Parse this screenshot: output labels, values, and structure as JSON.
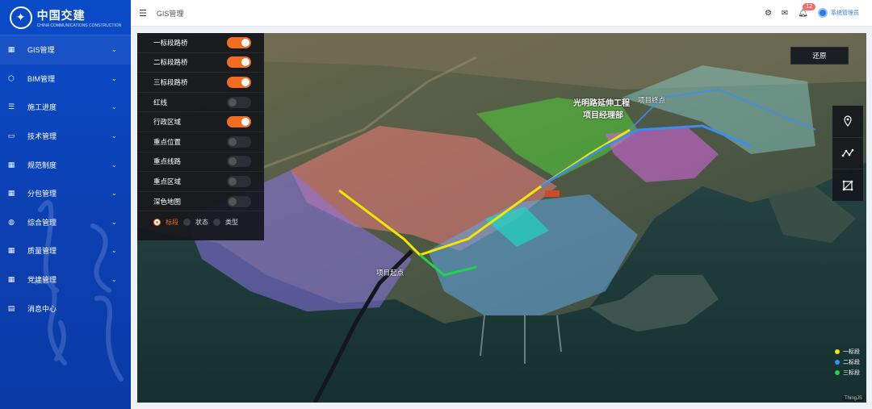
{
  "brand": {
    "name": "中国交建",
    "subtitle": "CHINA COMMUNICATIONS CONSTRUCTION"
  },
  "sidebar": {
    "items": [
      {
        "label": "GIS管理",
        "icon": "grid-icon",
        "active": true
      },
      {
        "label": "BIM管理",
        "icon": "cube-icon"
      },
      {
        "label": "施工进度",
        "icon": "list-icon"
      },
      {
        "label": "技术管理",
        "icon": "folder-icon"
      },
      {
        "label": "规范制度",
        "icon": "grid-icon"
      },
      {
        "label": "分包管理",
        "icon": "grid-icon"
      },
      {
        "label": "综合管理",
        "icon": "globe-icon"
      },
      {
        "label": "质量管理",
        "icon": "grid-icon"
      },
      {
        "label": "党建管理",
        "icon": "grid-icon"
      },
      {
        "label": "消息中心",
        "icon": "doc-icon"
      }
    ]
  },
  "header": {
    "breadcrumb": "GIS管理",
    "notification_count": "12",
    "user": "系统管理员"
  },
  "layers": {
    "items": [
      {
        "label": "一标段路桥",
        "on": true
      },
      {
        "label": "二标段路桥",
        "on": true
      },
      {
        "label": "三标段路桥",
        "on": true
      },
      {
        "label": "红线",
        "on": false
      },
      {
        "label": "行政区域",
        "on": true
      },
      {
        "label": "重点位置",
        "on": false
      },
      {
        "label": "重点线路",
        "on": false
      },
      {
        "label": "重点区域",
        "on": false
      },
      {
        "label": "深色地图",
        "on": false
      }
    ],
    "modes": [
      {
        "label": "标段",
        "on": true
      },
      {
        "label": "状态"
      },
      {
        "label": "类型"
      }
    ]
  },
  "map": {
    "reset": "还原",
    "labels": {
      "project_office_1": "光明路延伸工程",
      "project_office_2": "项目经理部",
      "end_point": "项目终点",
      "start_point": "项目起点"
    },
    "legend": [
      {
        "label": "一标段",
        "color": "#f3e600"
      },
      {
        "label": "二标段",
        "color": "#3c8df0"
      },
      {
        "label": "三标段",
        "color": "#24d24a"
      }
    ],
    "watermark": "ThingJS"
  },
  "colors": {
    "accent": "#f16d22",
    "sidebar": "#0b44bd"
  }
}
